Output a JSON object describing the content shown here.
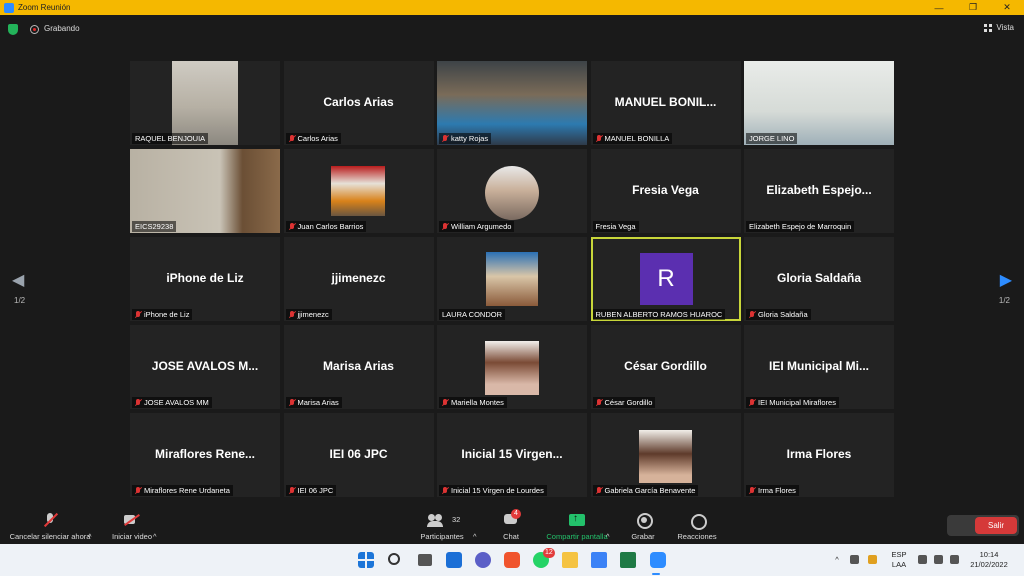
{
  "window": {
    "title": "Zoom Reunión"
  },
  "top": {
    "recording_label": "Grabando",
    "view_label": "Vista"
  },
  "pagination": {
    "left": "1/2",
    "right": "1/2"
  },
  "tiles": [
    {
      "label": "RAQUEL BENJOUIA",
      "display": "",
      "muted": false,
      "kind": "video-raquel"
    },
    {
      "label": "Carlos Arias",
      "display": "Carlos Arias",
      "muted": true,
      "kind": "name"
    },
    {
      "label": "katty Rojas",
      "display": "",
      "muted": true,
      "kind": "video-katty"
    },
    {
      "label": "MANUEL BONILLA",
      "display": "MANUEL  BONIL...",
      "muted": true,
      "kind": "name"
    },
    {
      "label": "JORGE LINO",
      "display": "",
      "muted": false,
      "kind": "video-jorge"
    },
    {
      "label": "EICS29238",
      "display": "",
      "muted": false,
      "kind": "video-eic"
    },
    {
      "label": "Juan Carlos Barrios",
      "display": "",
      "muted": true,
      "kind": "video-juan"
    },
    {
      "label": "William Argumedo",
      "display": "",
      "muted": true,
      "kind": "avatar-round"
    },
    {
      "label": "Fresia Vega",
      "display": "Fresia Vega",
      "muted": false,
      "kind": "name"
    },
    {
      "label": "Elizabeth Espejo de Marroquin",
      "display": "Elizabeth  Espejo...",
      "muted": false,
      "kind": "name"
    },
    {
      "label": "iPhone de Liz",
      "display": "iPhone de Liz",
      "muted": true,
      "kind": "name"
    },
    {
      "label": "jjimenezc",
      "display": "jjimenezc",
      "muted": true,
      "kind": "name"
    },
    {
      "label": "LAURA CONDOR",
      "display": "",
      "muted": false,
      "kind": "video-laura"
    },
    {
      "label": "RUBEN ALBERTO RAMOS HUAROC",
      "display": "R",
      "muted": false,
      "kind": "initial",
      "active": true
    },
    {
      "label": "Gloria Saldaña",
      "display": "Gloria Saldaña",
      "muted": true,
      "kind": "name"
    },
    {
      "label": "JOSE AVALOS MM",
      "display": "JOSE  AVALOS  M...",
      "muted": true,
      "kind": "name"
    },
    {
      "label": "Marisa Arias",
      "display": "Marisa Arias",
      "muted": true,
      "kind": "name"
    },
    {
      "label": "Mariella Montes",
      "display": "",
      "muted": true,
      "kind": "avatar-mariella"
    },
    {
      "label": "César Gordillo",
      "display": "César Gordillo",
      "muted": true,
      "kind": "name"
    },
    {
      "label": "IEI Municipal Miraflores",
      "display": "IEI  Municipal  Mi...",
      "muted": true,
      "kind": "name"
    },
    {
      "label": "Miraflores Rene Urdaneta",
      "display": "Miraflores  Rene...",
      "muted": true,
      "kind": "name"
    },
    {
      "label": "IEI 06 JPC",
      "display": "IEI 06 JPC",
      "muted": true,
      "kind": "name"
    },
    {
      "label": "Inicial 15 Virgen de Lourdes",
      "display": "Inicial  15  Virgen...",
      "muted": true,
      "kind": "name"
    },
    {
      "label": "Gabriela García Benavente",
      "display": "",
      "muted": true,
      "kind": "avatar-gabriela"
    },
    {
      "label": "Irma Flores",
      "display": "Irma Flores",
      "muted": true,
      "kind": "name"
    }
  ],
  "toolbar": {
    "unmute": "Cancelar silenciar ahora",
    "start_video": "Iniciar video",
    "participants": "Participantes",
    "participants_count": "32",
    "chat": "Chat",
    "chat_badge": "4",
    "share": "Compartir pantalla",
    "record": "Grabar",
    "reactions": "Reacciones",
    "leave": "Salir"
  },
  "taskbar": {
    "whatsapp_badge": "12",
    "lang_top": "ESP",
    "lang_bottom": "LAA",
    "time": "10:14",
    "date": "21/02/2022"
  }
}
